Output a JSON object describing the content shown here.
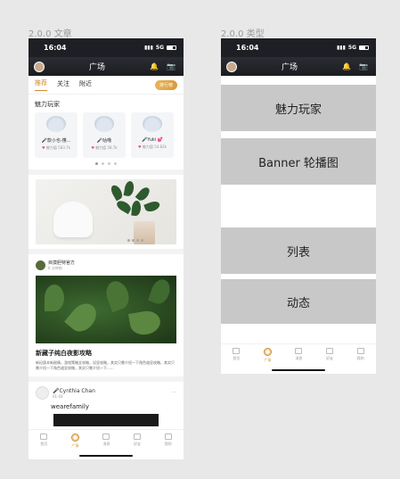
{
  "labels": {
    "left": "2.0.0 文章",
    "right": "2.0.0 类型"
  },
  "status": {
    "time": "16:04",
    "network": "5G"
  },
  "nav": {
    "title": "广场"
  },
  "tabs": [
    "推荐",
    "关注",
    "附近"
  ],
  "rank_button": "排行榜",
  "charm_section": "魅力玩家",
  "players": [
    {
      "name": "🎤款小也-懂...",
      "meta": "魅力值 583.7k"
    },
    {
      "name": "🎤咕噜",
      "meta": "魅力值 58.7k"
    },
    {
      "name": "🎤Yuki 💕",
      "meta": "魅力值 54.82k"
    }
  ],
  "feed": {
    "user": "目摸胆特官方",
    "time": "6 分钟前",
    "title": "新藏子纯白夜影攻略",
    "desc": "新纪版本新剧情，游戏策略全攻略，设显攻略，其实只需介绍一下角色道显攻略，其实只需介绍一下角色道显攻略，其实只需介绍一下......"
  },
  "post": {
    "name": "🎤Cynthia Chan",
    "date": "01-04",
    "text": "wearefamily",
    "more": "···"
  },
  "tabbar": [
    {
      "label": "首页",
      "active": false
    },
    {
      "label": "广场",
      "active": true
    },
    {
      "label": "消息",
      "active": false
    },
    {
      "label": "好友",
      "active": false
    },
    {
      "label": "我的",
      "active": false
    }
  ],
  "blocks": [
    "魅力玩家",
    "Banner 轮播图",
    "列表",
    "动态"
  ],
  "colors": {
    "accent": "#d08b2d",
    "block": "#c8c8c8",
    "navbar": "#1d1f24"
  }
}
